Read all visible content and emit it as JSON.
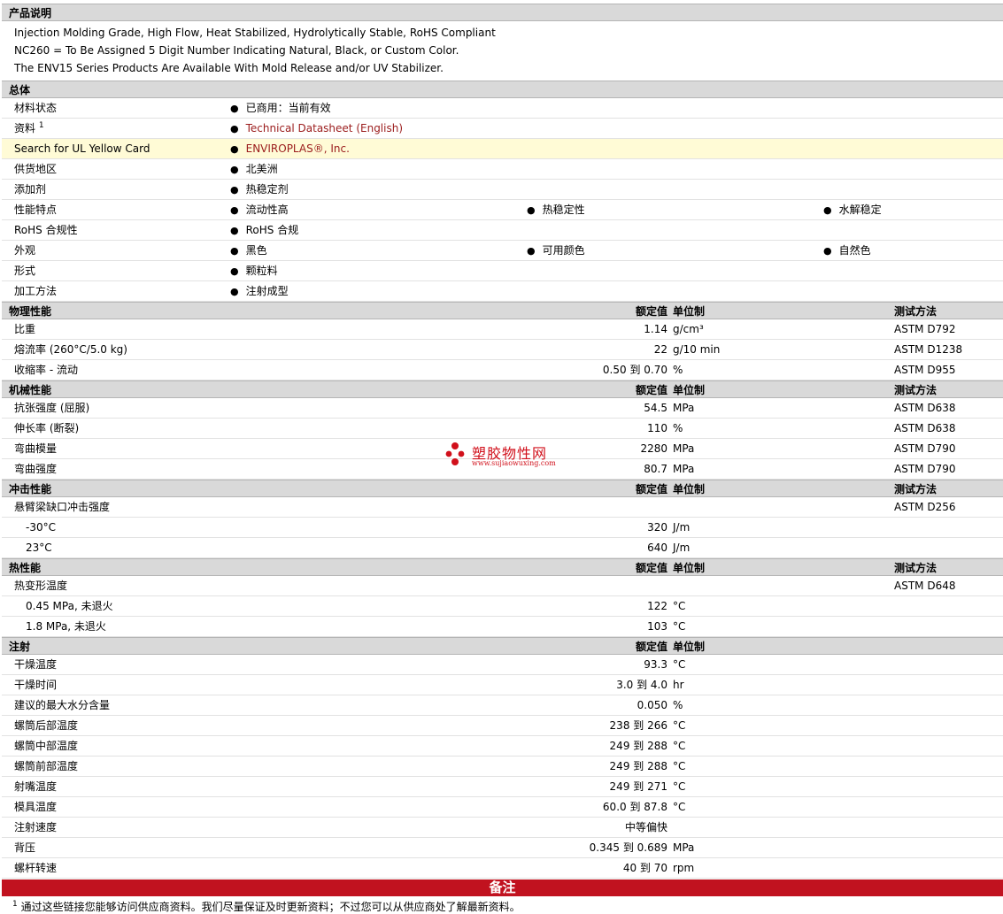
{
  "description": {
    "title": "产品说明",
    "lines": [
      "Injection Molding Grade, High Flow, Heat Stabilized, Hydrolytically Stable, RoHS Compliant",
      "NC260 = To Be Assigned 5 Digit Number Indicating Natural, Black, or Custom Color.",
      "The ENV15 Series Products Are Available With Mold Release and/or UV Stabilizer."
    ]
  },
  "general": {
    "title": "总体",
    "material_status": {
      "label": "材料状态",
      "value": "已商用：当前有效"
    },
    "literature": {
      "label": "资料",
      "sup": "1",
      "value": "Technical Datasheet (English)"
    },
    "ul_card": {
      "label": "Search for UL Yellow Card",
      "value": "ENVIROPLAS®, Inc."
    },
    "availability": {
      "label": "供货地区",
      "value": "北美洲"
    },
    "additive": {
      "label": "添加剂",
      "value": "热稳定剂"
    },
    "features": {
      "label": "性能特点",
      "v1": "流动性高",
      "v2": "热稳定性",
      "v3": "水解稳定"
    },
    "rohs": {
      "label": "RoHS 合规性",
      "value": "RoHS 合规"
    },
    "appearance": {
      "label": "外观",
      "v1": "黑色",
      "v2": "可用颜色",
      "v3": "自然色"
    },
    "form": {
      "label": "形式",
      "value": "颗粒料"
    },
    "processing": {
      "label": "加工方法",
      "value": "注射成型"
    }
  },
  "headers": {
    "value": "额定值",
    "unit": "单位制",
    "method": "测试方法"
  },
  "physical": {
    "title": "物理性能",
    "rows": [
      {
        "label": "比重",
        "value": "1.14",
        "unit": "g/cm³",
        "method": "ASTM D792"
      },
      {
        "label": "熔流率 (260°C/5.0 kg)",
        "value": "22",
        "unit": "g/10 min",
        "method": "ASTM D1238"
      },
      {
        "label": "收缩率 - 流动",
        "value": "0.50 到  0.70",
        "unit": "%",
        "method": "ASTM D955"
      }
    ]
  },
  "mechanical": {
    "title": "机械性能",
    "rows": [
      {
        "label": "抗张强度 (屈服)",
        "value": "54.5",
        "unit": "MPa",
        "method": "ASTM D638"
      },
      {
        "label": "伸长率 (断裂)",
        "value": "110",
        "unit": "%",
        "method": "ASTM D638"
      },
      {
        "label": "弯曲模量",
        "value": "2280",
        "unit": "MPa",
        "method": "ASTM D790"
      },
      {
        "label": "弯曲强度",
        "value": "80.7",
        "unit": "MPa",
        "method": "ASTM D790"
      }
    ]
  },
  "impact": {
    "title": "冲击性能",
    "main": {
      "label": "悬臂梁缺口冲击强度",
      "method": "ASTM D256"
    },
    "rows": [
      {
        "label": "-30°C",
        "value": "320",
        "unit": "J/m"
      },
      {
        "label": "23°C",
        "value": "640",
        "unit": "J/m"
      }
    ]
  },
  "thermal": {
    "title": "热性能",
    "main": {
      "label": "热变形温度",
      "method": "ASTM D648"
    },
    "rows": [
      {
        "label": "0.45 MPa, 未退火",
        "value": "122",
        "unit": "°C"
      },
      {
        "label": "1.8 MPa, 未退火",
        "value": "103",
        "unit": "°C"
      }
    ]
  },
  "injection": {
    "title": "注射",
    "rows": [
      {
        "label": "干燥温度",
        "value": "93.3",
        "unit": "°C"
      },
      {
        "label": "干燥时间",
        "value": "3.0 到  4.0",
        "unit": "hr"
      },
      {
        "label": "建议的最大水分含量",
        "value": "0.050",
        "unit": "%"
      },
      {
        "label": "螺筒后部温度",
        "value": "238 到  266",
        "unit": "°C"
      },
      {
        "label": "螺筒中部温度",
        "value": "249 到  288",
        "unit": "°C"
      },
      {
        "label": "螺筒前部温度",
        "value": "249 到  288",
        "unit": "°C"
      },
      {
        "label": "射嘴温度",
        "value": "249 到  271",
        "unit": "°C"
      },
      {
        "label": "模具温度",
        "value": "60.0 到  87.8",
        "unit": "°C"
      },
      {
        "label": "注射速度",
        "value": "中等偏快",
        "unit": ""
      },
      {
        "label": "背压",
        "value": "0.345 到  0.689",
        "unit": "MPa"
      },
      {
        "label": "螺杆转速",
        "value": "40 到  70",
        "unit": "rpm"
      }
    ]
  },
  "notes": {
    "title": "备注",
    "footnote_num": "1",
    "footnote": "通过这些链接您能够访问供应商资料。我们尽量保证及时更新资料；不过您可以从供应商处了解最新资料。"
  },
  "watermark": {
    "cn": "塑胶物性网",
    "en": "www.sujiaowuxing.com"
  },
  "colors": {
    "section_bg": "#d9d9d9",
    "highlight_bg": "#fffbd6",
    "link": "#9b1c1c",
    "notes_bar": "#c1121f"
  }
}
